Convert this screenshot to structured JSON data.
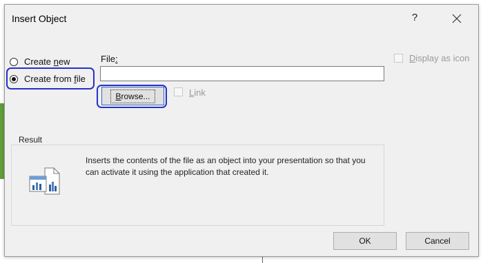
{
  "dialog": {
    "title": "Insert Object",
    "help_label": "?",
    "close_icon": "close-icon"
  },
  "options": {
    "create_new": {
      "prefix": "Create ",
      "accel": "n",
      "suffix": "ew",
      "checked": false
    },
    "create_from_file": {
      "prefix": "Create from ",
      "accel": "f",
      "suffix": "ile",
      "checked": true
    }
  },
  "file": {
    "label_prefix": "File",
    "label_accel": ":",
    "value": ""
  },
  "browse": {
    "prefix": "",
    "accel": "B",
    "suffix": "rowse..."
  },
  "link": {
    "accel": "L",
    "suffix": "ink",
    "checked": false,
    "enabled": false
  },
  "display_as_icon": {
    "accel": "D",
    "suffix": "isplay as icon",
    "checked": false,
    "enabled": false
  },
  "result": {
    "label": "Result",
    "icon": "embedded-object-chart-icon",
    "text": "Inserts the contents of the file as an object into your presentation so that you can activate it using the application that created it."
  },
  "buttons": {
    "ok": "OK",
    "cancel": "Cancel"
  },
  "colors": {
    "highlight": "#2630c8",
    "focus_border": "#2f68c9",
    "dialog_bg": "#f0f0f0"
  }
}
